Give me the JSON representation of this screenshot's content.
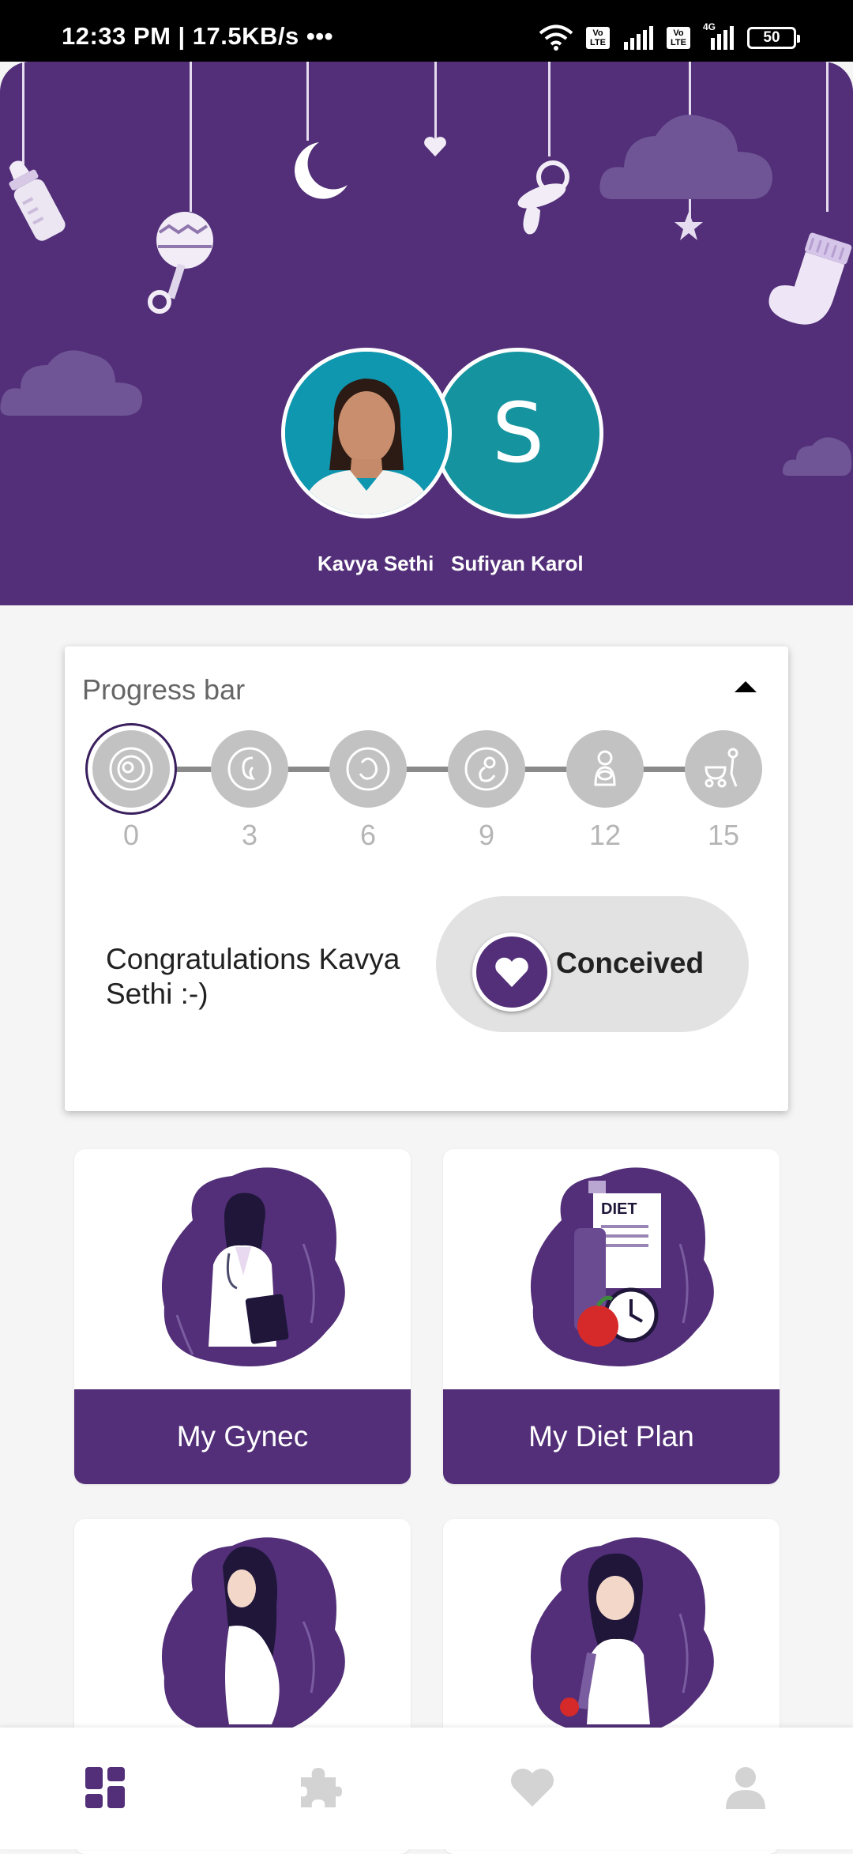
{
  "status_bar": {
    "time_speed": "12:33 PM | 17.5KB/s •••",
    "battery": "50",
    "network_badges": [
      "Vo LTE",
      "Vo LTE"
    ],
    "network_type": "4G"
  },
  "header": {
    "partners": [
      {
        "name": "Kavya Sethi",
        "avatar": "photo"
      },
      {
        "name": "Sufiyan Karol",
        "avatar_letter": "S"
      }
    ]
  },
  "progress": {
    "title": "Progress bar",
    "steps": [
      "0",
      "3",
      "6",
      "9",
      "12",
      "15"
    ],
    "active_step": "0",
    "message": "Congratulations Kavya Sethi :-)",
    "toggle_label": "Conceived"
  },
  "features": [
    {
      "label": "My Gynec"
    },
    {
      "label": "My Diet Plan"
    },
    {
      "label": ""
    },
    {
      "label": ""
    }
  ],
  "bottom_nav": [
    {
      "icon": "dashboard-icon",
      "active": true
    },
    {
      "icon": "puzzle-icon",
      "active": false
    },
    {
      "icon": "heart-icon",
      "active": false
    },
    {
      "icon": "profile-icon",
      "active": false
    }
  ],
  "colors": {
    "primary": "#522f78",
    "accent_teal": "#15939f",
    "step_inactive": "#c2c2c2",
    "nav_inactive": "#d3d3d3"
  }
}
